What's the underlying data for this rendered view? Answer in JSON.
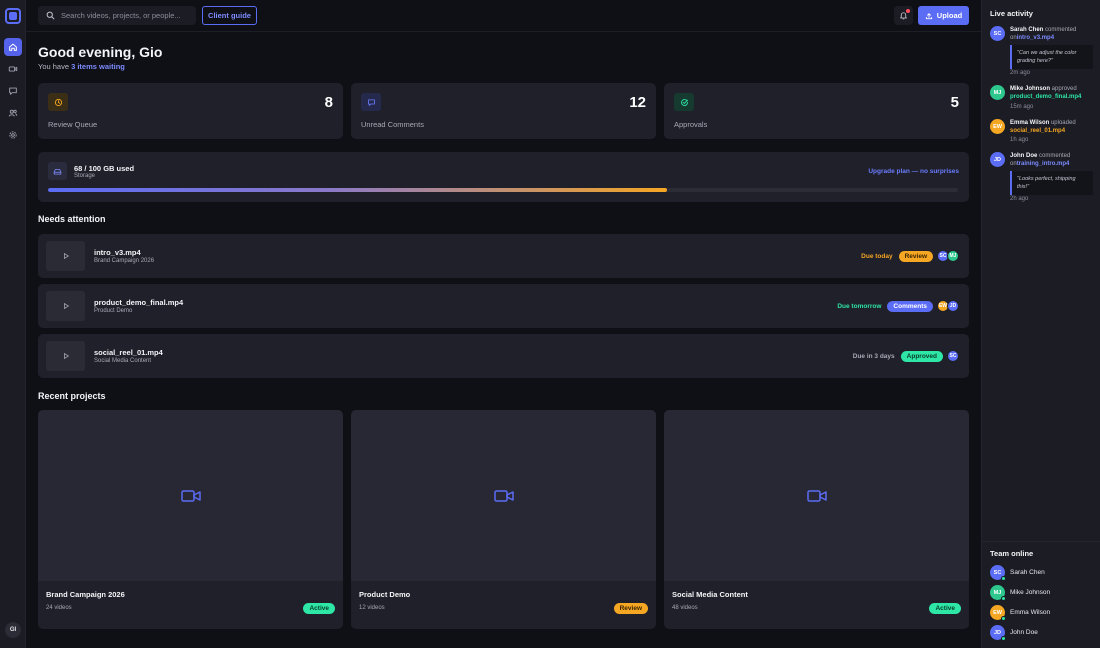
{
  "search": {
    "placeholder": "Search videos, projects, or people..."
  },
  "header": {
    "client_guide": "Client guide",
    "upload": "Upload"
  },
  "user": {
    "initials": "GI"
  },
  "greeting": {
    "title": "Good evening, Gio",
    "prefix": "You have ",
    "highlight": "3 items waiting"
  },
  "stats": [
    {
      "label": "Review Queue",
      "value": "8",
      "icon": "clock-icon",
      "color": "#f5a623"
    },
    {
      "label": "Unread Comments",
      "value": "12",
      "icon": "comment-icon",
      "color": "#5b6cf5"
    },
    {
      "label": "Approvals",
      "value": "5",
      "icon": "check-circle-icon",
      "color": "#2ee6a6"
    }
  ],
  "storage": {
    "used": "68 / 100 GB used",
    "label": "Storage",
    "link": "Upgrade plan — no surprises",
    "percent": 68
  },
  "attention": {
    "title": "Needs attention",
    "items": [
      {
        "name": "intro_v3.mp4",
        "project": "Brand Campaign 2026",
        "due": "Due today",
        "due_color": "#f5a623",
        "badge": "Review",
        "badge_bg": "#f5a623",
        "badge_fg": "#3a2500",
        "avatars": [
          {
            "initials": "SC",
            "color": "#5b6cf5"
          },
          {
            "initials": "MJ",
            "color": "#2ec88f"
          }
        ]
      },
      {
        "name": "product_demo_final.mp4",
        "project": "Product Demo",
        "due": "Due tomorrow",
        "due_color": "#2ee6a6",
        "badge": "Comments",
        "badge_bg": "#5b6cf5",
        "badge_fg": "#ffffff",
        "avatars": [
          {
            "initials": "EW",
            "color": "#f5a623"
          },
          {
            "initials": "JD",
            "color": "#5b6cf5"
          }
        ]
      },
      {
        "name": "social_reel_01.mp4",
        "project": "Social Media Content",
        "due": "Due in 3 days",
        "due_color": "#a6a8b5",
        "badge": "Approved",
        "badge_bg": "#2ee6a6",
        "badge_fg": "#073d2a",
        "avatars": [
          {
            "initials": "SC",
            "color": "#5b6cf5"
          }
        ]
      }
    ]
  },
  "recent": {
    "title": "Recent projects",
    "items": [
      {
        "name": "Brand Campaign 2026",
        "count": "24 videos",
        "badge": "Active",
        "badge_bg": "#2ee6a6",
        "badge_fg": "#073d2a"
      },
      {
        "name": "Product Demo",
        "count": "12 videos",
        "badge": "Review",
        "badge_bg": "#f5a623",
        "badge_fg": "#3a2500"
      },
      {
        "name": "Social Media Content",
        "count": "48 videos",
        "badge": "Active",
        "badge_bg": "#2ee6a6",
        "badge_fg": "#073d2a"
      }
    ]
  },
  "activity": {
    "title": "Live activity",
    "items": [
      {
        "initials": "SC",
        "color": "#5b6cf5",
        "name": "Sarah Chen",
        "action": " commented on",
        "file": "intro_v3.mp4",
        "file_color": "blue",
        "quote": "\"Can we adjust the color grading here?\"",
        "time": "2m ago"
      },
      {
        "initials": "MJ",
        "color": "#2ec88f",
        "name": "Mike Johnson",
        "action": " approved ",
        "file": "product_demo_final.mp4",
        "file_color": "green",
        "quote": "",
        "time": "15m ago"
      },
      {
        "initials": "EW",
        "color": "#f5a623",
        "name": "Emma Wilson",
        "action": " uploaded ",
        "file": "social_reel_01.mp4",
        "file_color": "orange",
        "quote": "",
        "time": "1h ago"
      },
      {
        "initials": "JD",
        "color": "#5b6cf5",
        "name": "John Doe",
        "action": " commented on",
        "file": "training_intro.mp4",
        "file_color": "blue",
        "quote": "\"Looks perfect, shipping this!\"",
        "time": "2h ago"
      }
    ]
  },
  "team": {
    "title": "Team online",
    "members": [
      {
        "initials": "SC",
        "name": "Sarah Chen",
        "color": "#5b6cf5"
      },
      {
        "initials": "MJ",
        "name": "Mike Johnson",
        "color": "#2ec88f"
      },
      {
        "initials": "EW",
        "name": "Emma Wilson",
        "color": "#f5a623"
      },
      {
        "initials": "JD",
        "name": "John Doe",
        "color": "#5b6cf5"
      }
    ]
  }
}
